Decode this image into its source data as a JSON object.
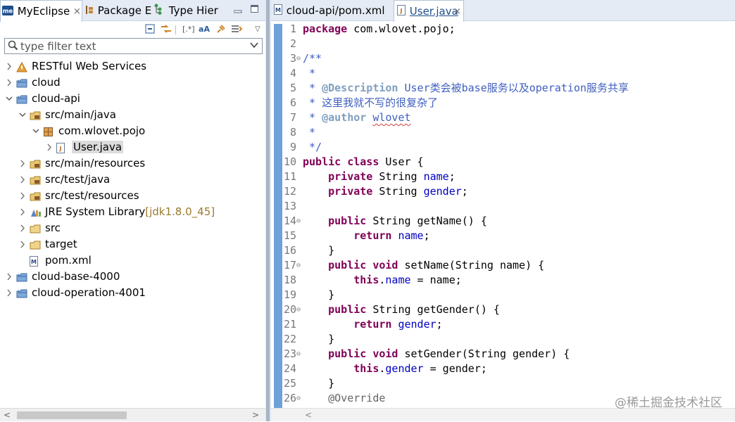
{
  "left_panel": {
    "tabs": [
      {
        "label": "MyEclipse",
        "icon": "myeclipse-icon"
      },
      {
        "label": "Package E",
        "icon": "package-explorer-icon"
      },
      {
        "label": "Type Hier",
        "icon": "type-hierarchy-icon"
      }
    ],
    "close_glyph": "×",
    "filter": {
      "placeholder": "type filter text"
    },
    "tree": [
      {
        "label": "RESTful Web Services",
        "icon": "restful-services-icon",
        "expanded": false,
        "depth": 0
      },
      {
        "label": "cloud",
        "icon": "project-icon",
        "expanded": false,
        "depth": 0
      },
      {
        "label": "cloud-api",
        "icon": "project-icon",
        "expanded": true,
        "depth": 0
      },
      {
        "label": "src/main/java",
        "icon": "source-folder-icon",
        "expanded": true,
        "depth": 1
      },
      {
        "label": "com.wlovet.pojo",
        "icon": "package-icon",
        "expanded": true,
        "depth": 2
      },
      {
        "label": "User.java",
        "icon": "java-file-icon",
        "expanded": false,
        "depth": 3,
        "selected": true
      },
      {
        "label": "src/main/resources",
        "icon": "source-folder-icon",
        "expanded": false,
        "depth": 1
      },
      {
        "label": "src/test/java",
        "icon": "source-folder-icon",
        "expanded": false,
        "depth": 1
      },
      {
        "label": "src/test/resources",
        "icon": "source-folder-icon",
        "expanded": false,
        "depth": 1
      },
      {
        "label": "JRE System Library",
        "decoration": "[jdk1.8.0_45]",
        "icon": "library-icon",
        "expanded": false,
        "depth": 1
      },
      {
        "label": "src",
        "icon": "folder-icon",
        "expanded": false,
        "depth": 1
      },
      {
        "label": "target",
        "icon": "folder-icon",
        "expanded": false,
        "depth": 1
      },
      {
        "label": "pom.xml",
        "icon": "maven-file-icon",
        "leaf": true,
        "depth": 1
      },
      {
        "label": "cloud-base-4000",
        "icon": "project-icon",
        "expanded": false,
        "depth": 0
      },
      {
        "label": "cloud-operation-4001",
        "icon": "project-icon",
        "expanded": false,
        "depth": 0
      }
    ]
  },
  "editor": {
    "tabs": [
      {
        "label": "cloud-api/pom.xml",
        "active": false
      },
      {
        "label": "User.java",
        "active": true
      }
    ],
    "close_glyph": "×",
    "lines": [
      {
        "n": "1",
        "fold": false,
        "tokens": [
          {
            "t": "package",
            "c": "kw"
          },
          {
            "t": " com.wlovet.pojo;",
            "c": ""
          }
        ]
      },
      {
        "n": "2",
        "fold": false,
        "tokens": []
      },
      {
        "n": "3",
        "fold": true,
        "tokens": [
          {
            "t": "/**",
            "c": "cm"
          }
        ]
      },
      {
        "n": "4",
        "fold": false,
        "tokens": [
          {
            "t": " *",
            "c": "cm"
          }
        ]
      },
      {
        "n": "5",
        "fold": false,
        "tokens": [
          {
            "t": " * ",
            "c": "cm"
          },
          {
            "t": "@Description",
            "c": "tag"
          },
          {
            "t": " User类会被base服务以及operation服务共享",
            "c": "cm"
          }
        ]
      },
      {
        "n": "6",
        "fold": false,
        "tokens": [
          {
            "t": " * 这里我就不写的很复杂了",
            "c": "cm"
          }
        ]
      },
      {
        "n": "7",
        "fold": false,
        "tokens": [
          {
            "t": " * ",
            "c": "cm"
          },
          {
            "t": "@author",
            "c": "tag"
          },
          {
            "t": " ",
            "c": "cm"
          },
          {
            "t": "wlovet",
            "c": "cm squig"
          }
        ]
      },
      {
        "n": "8",
        "fold": false,
        "tokens": [
          {
            "t": " *",
            "c": "cm"
          }
        ]
      },
      {
        "n": "9",
        "fold": false,
        "tokens": [
          {
            "t": " */",
            "c": "cm"
          }
        ]
      },
      {
        "n": "10",
        "fold": false,
        "tokens": [
          {
            "t": "public",
            "c": "kw"
          },
          {
            "t": " ",
            "c": ""
          },
          {
            "t": "class",
            "c": "kw"
          },
          {
            "t": " User {",
            "c": ""
          }
        ]
      },
      {
        "n": "11",
        "fold": false,
        "tokens": [
          {
            "t": "    ",
            "c": ""
          },
          {
            "t": "private",
            "c": "kw"
          },
          {
            "t": " String ",
            "c": ""
          },
          {
            "t": "name",
            "c": "fld"
          },
          {
            "t": ";",
            "c": ""
          }
        ]
      },
      {
        "n": "12",
        "fold": false,
        "tokens": [
          {
            "t": "    ",
            "c": ""
          },
          {
            "t": "private",
            "c": "kw"
          },
          {
            "t": " String ",
            "c": ""
          },
          {
            "t": "gender",
            "c": "fld"
          },
          {
            "t": ";",
            "c": ""
          }
        ]
      },
      {
        "n": "13",
        "fold": false,
        "tokens": []
      },
      {
        "n": "14",
        "fold": true,
        "tokens": [
          {
            "t": "    ",
            "c": ""
          },
          {
            "t": "public",
            "c": "kw"
          },
          {
            "t": " String getName() {",
            "c": ""
          }
        ]
      },
      {
        "n": "15",
        "fold": false,
        "tokens": [
          {
            "t": "        ",
            "c": ""
          },
          {
            "t": "return",
            "c": "kw"
          },
          {
            "t": " ",
            "c": ""
          },
          {
            "t": "name",
            "c": "fld"
          },
          {
            "t": ";",
            "c": ""
          }
        ]
      },
      {
        "n": "16",
        "fold": false,
        "tokens": [
          {
            "t": "    }",
            "c": ""
          }
        ]
      },
      {
        "n": "17",
        "fold": true,
        "tokens": [
          {
            "t": "    ",
            "c": ""
          },
          {
            "t": "public",
            "c": "kw"
          },
          {
            "t": " ",
            "c": ""
          },
          {
            "t": "void",
            "c": "kw"
          },
          {
            "t": " setName(String name) {",
            "c": ""
          }
        ]
      },
      {
        "n": "18",
        "fold": false,
        "tokens": [
          {
            "t": "        ",
            "c": ""
          },
          {
            "t": "this",
            "c": "kw"
          },
          {
            "t": ".",
            "c": ""
          },
          {
            "t": "name",
            "c": "fld"
          },
          {
            "t": " = name;",
            "c": ""
          }
        ]
      },
      {
        "n": "19",
        "fold": false,
        "tokens": [
          {
            "t": "    }",
            "c": ""
          }
        ]
      },
      {
        "n": "20",
        "fold": true,
        "tokens": [
          {
            "t": "    ",
            "c": ""
          },
          {
            "t": "public",
            "c": "kw"
          },
          {
            "t": " String getGender() {",
            "c": ""
          }
        ]
      },
      {
        "n": "21",
        "fold": false,
        "tokens": [
          {
            "t": "        ",
            "c": ""
          },
          {
            "t": "return",
            "c": "kw"
          },
          {
            "t": " ",
            "c": ""
          },
          {
            "t": "gender",
            "c": "fld"
          },
          {
            "t": ";",
            "c": ""
          }
        ]
      },
      {
        "n": "22",
        "fold": false,
        "tokens": [
          {
            "t": "    }",
            "c": ""
          }
        ]
      },
      {
        "n": "23",
        "fold": true,
        "tokens": [
          {
            "t": "    ",
            "c": ""
          },
          {
            "t": "public",
            "c": "kw"
          },
          {
            "t": " ",
            "c": ""
          },
          {
            "t": "void",
            "c": "kw"
          },
          {
            "t": " setGender(String gender) {",
            "c": ""
          }
        ]
      },
      {
        "n": "24",
        "fold": false,
        "tokens": [
          {
            "t": "        ",
            "c": ""
          },
          {
            "t": "this",
            "c": "kw"
          },
          {
            "t": ".",
            "c": ""
          },
          {
            "t": "gender",
            "c": "fld"
          },
          {
            "t": " = gender;",
            "c": ""
          }
        ]
      },
      {
        "n": "25",
        "fold": false,
        "tokens": [
          {
            "t": "    }",
            "c": ""
          }
        ]
      },
      {
        "n": "26",
        "fold": true,
        "tokens": [
          {
            "t": "    ",
            "c": ""
          },
          {
            "t": "@Override",
            "c": "ann"
          }
        ]
      }
    ]
  },
  "watermark": "@稀土掘金技术社区",
  "colors": {
    "keyword": "#7f0055",
    "field": "#0000c0",
    "javadoc": "#3f5fbf",
    "javadoc_tag": "#7f9fbf",
    "gutter": "#6fa0d8"
  }
}
